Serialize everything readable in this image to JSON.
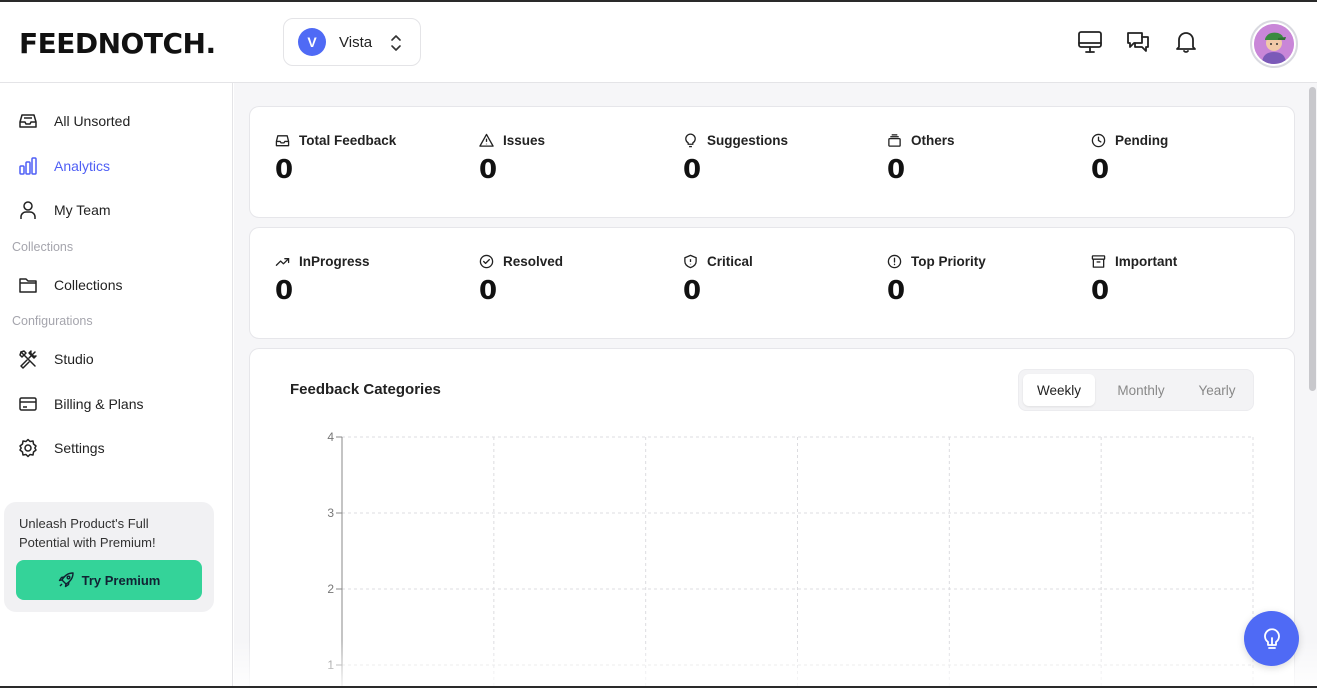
{
  "header": {
    "logo": "FEEDNOTCH.",
    "workspace": {
      "initial": "V",
      "name": "Vista"
    },
    "icons": [
      "monitor-icon",
      "chat-icon",
      "bell-icon"
    ]
  },
  "sidebar": {
    "items": [
      {
        "label": "All Unsorted",
        "icon": "inbox-icon"
      },
      {
        "label": "Analytics",
        "icon": "bar-chart-icon",
        "active": true
      },
      {
        "label": "My Team",
        "icon": "user-icon"
      }
    ],
    "section_collections": "Collections",
    "collections_items": [
      {
        "label": "Collections",
        "icon": "folder-icon"
      }
    ],
    "section_configurations": "Configurations",
    "config_items": [
      {
        "label": "Studio",
        "icon": "tools-icon"
      },
      {
        "label": "Billing & Plans",
        "icon": "credit-card-icon"
      },
      {
        "label": "Settings",
        "icon": "gear-icon"
      }
    ],
    "promo": {
      "text": "Unleash Product's Full Potential with Premium!",
      "button": "Try Premium"
    }
  },
  "stats_row1": [
    {
      "label": "Total Feedback",
      "value": "0",
      "icon": "inbox-icon"
    },
    {
      "label": "Issues",
      "value": "0",
      "icon": "warning-icon"
    },
    {
      "label": "Suggestions",
      "value": "0",
      "icon": "lightbulb-icon"
    },
    {
      "label": "Others",
      "value": "0",
      "icon": "stack-icon"
    },
    {
      "label": "Pending",
      "value": "0",
      "icon": "clock-icon"
    }
  ],
  "stats_row2": [
    {
      "label": "InProgress",
      "value": "0",
      "icon": "trend-up-icon"
    },
    {
      "label": "Resolved",
      "value": "0",
      "icon": "check-circle-icon"
    },
    {
      "label": "Critical",
      "value": "0",
      "icon": "shield-icon"
    },
    {
      "label": "Top Priority",
      "value": "0",
      "icon": "alert-circle-icon"
    },
    {
      "label": "Important",
      "value": "0",
      "icon": "archive-icon"
    }
  ],
  "chart_panel": {
    "title": "Feedback Categories",
    "periods": [
      "Weekly",
      "Monthly",
      "Yearly"
    ],
    "active_period": "Weekly"
  },
  "chart_data": {
    "type": "bar",
    "title": "Feedback Categories",
    "categories": [],
    "values": [],
    "y_ticks": [
      1,
      2,
      3,
      4
    ],
    "ylim": [
      0,
      4
    ],
    "grid": true
  },
  "colors": {
    "accent": "#4f5ff5",
    "premium": "#34d399",
    "fab": "#4f6af5"
  }
}
